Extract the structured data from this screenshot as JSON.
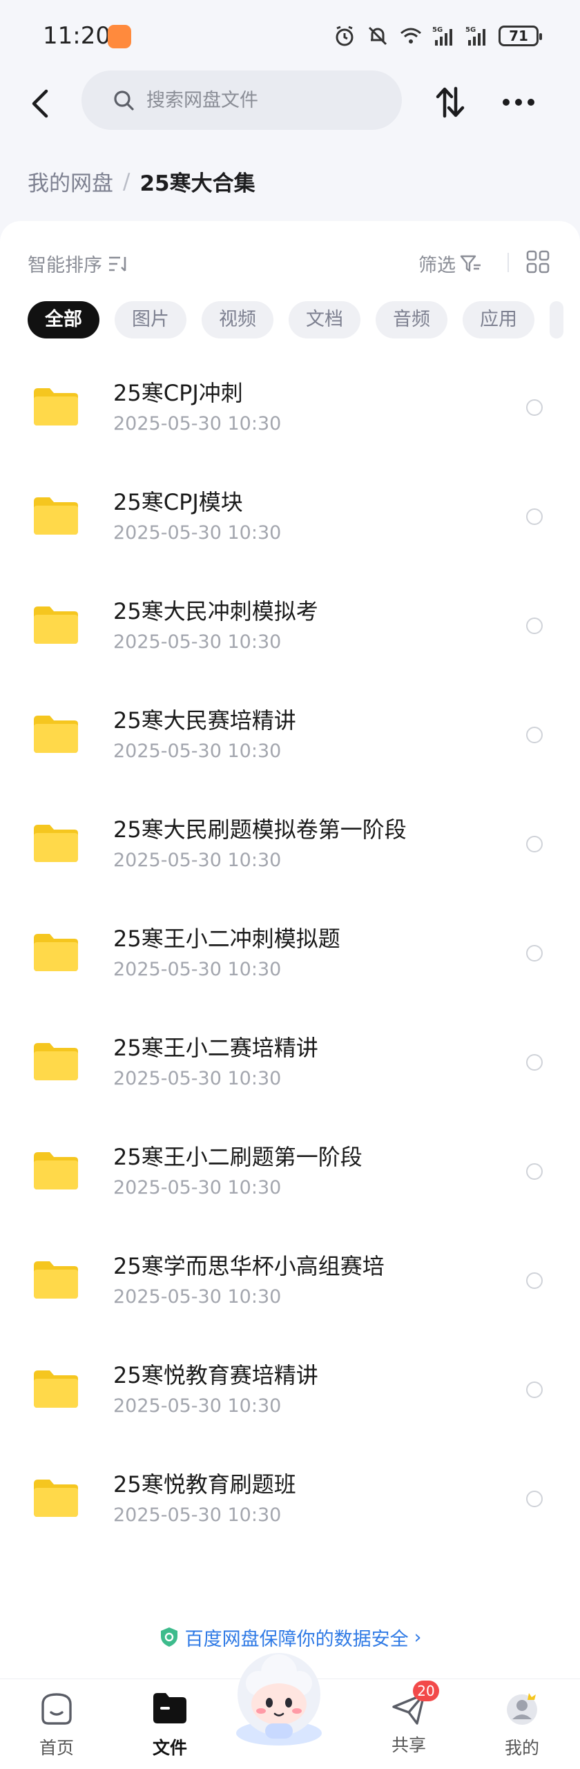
{
  "status_bar": {
    "time": "11:20",
    "battery": "71",
    "icons": [
      "alarm-icon",
      "mute-icon",
      "wifi-icon",
      "signal-5g-icon",
      "signal-5g-icon"
    ]
  },
  "header": {
    "search_placeholder": "搜索网盘文件"
  },
  "breadcrumb": {
    "root": "我的网盘",
    "separator": "/",
    "current": "25寒大合集"
  },
  "toolbar": {
    "sort_label": "智能排序",
    "filter_label": "筛选"
  },
  "tabs": [
    {
      "label": "全部",
      "active": true
    },
    {
      "label": "图片",
      "active": false
    },
    {
      "label": "视频",
      "active": false
    },
    {
      "label": "文档",
      "active": false
    },
    {
      "label": "音频",
      "active": false
    },
    {
      "label": "应用",
      "active": false
    }
  ],
  "files": [
    {
      "name": "25寒CPJ冲刺",
      "date": "2025-05-30  10:30"
    },
    {
      "name": "25寒CPJ模块",
      "date": "2025-05-30  10:30"
    },
    {
      "name": "25寒大民冲刺模拟考",
      "date": "2025-05-30  10:30"
    },
    {
      "name": "25寒大民赛培精讲",
      "date": "2025-05-30  10:30"
    },
    {
      "name": "25寒大民刷题模拟卷第一阶段",
      "date": "2025-05-30  10:30"
    },
    {
      "name": "25寒王小二冲刺模拟题",
      "date": "2025-05-30  10:30"
    },
    {
      "name": "25寒王小二赛培精讲",
      "date": "2025-05-30  10:30"
    },
    {
      "name": "25寒王小二刷题第一阶段",
      "date": "2025-05-30  10:30"
    },
    {
      "name": "25寒学而思华杯小高组赛培",
      "date": "2025-05-30  10:30"
    },
    {
      "name": "25寒悦教育赛培精讲",
      "date": "2025-05-30  10:30"
    },
    {
      "name": "25寒悦教育刷题班",
      "date": "2025-05-30  10:30"
    }
  ],
  "banner": {
    "text": "百度网盘保障你的数据安全",
    "arrow": "›"
  },
  "bottom_nav": {
    "home": "首页",
    "files": "文件",
    "share": "共享",
    "share_badge": "20",
    "mine": "我的"
  },
  "colors": {
    "folder": "#ffd23f",
    "accent": "#2f7ae5",
    "badge": "#f24a4a"
  }
}
